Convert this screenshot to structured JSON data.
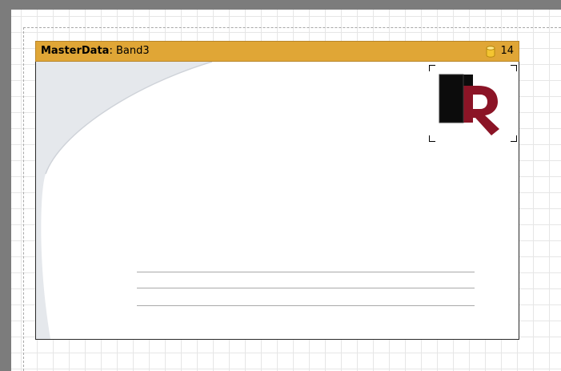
{
  "band": {
    "type_label": "MasterData",
    "separator": ":",
    "name": "Band3",
    "count": "14"
  },
  "icons": {
    "datasource": "database-icon",
    "logo": "fastreport-logo-picture"
  },
  "colors": {
    "band_header": "#e0a636",
    "canvas": "#7c7c7c",
    "grid": "#e6e6e6",
    "swoosh": "#e5e8ec"
  },
  "lines": {
    "count": 3
  }
}
